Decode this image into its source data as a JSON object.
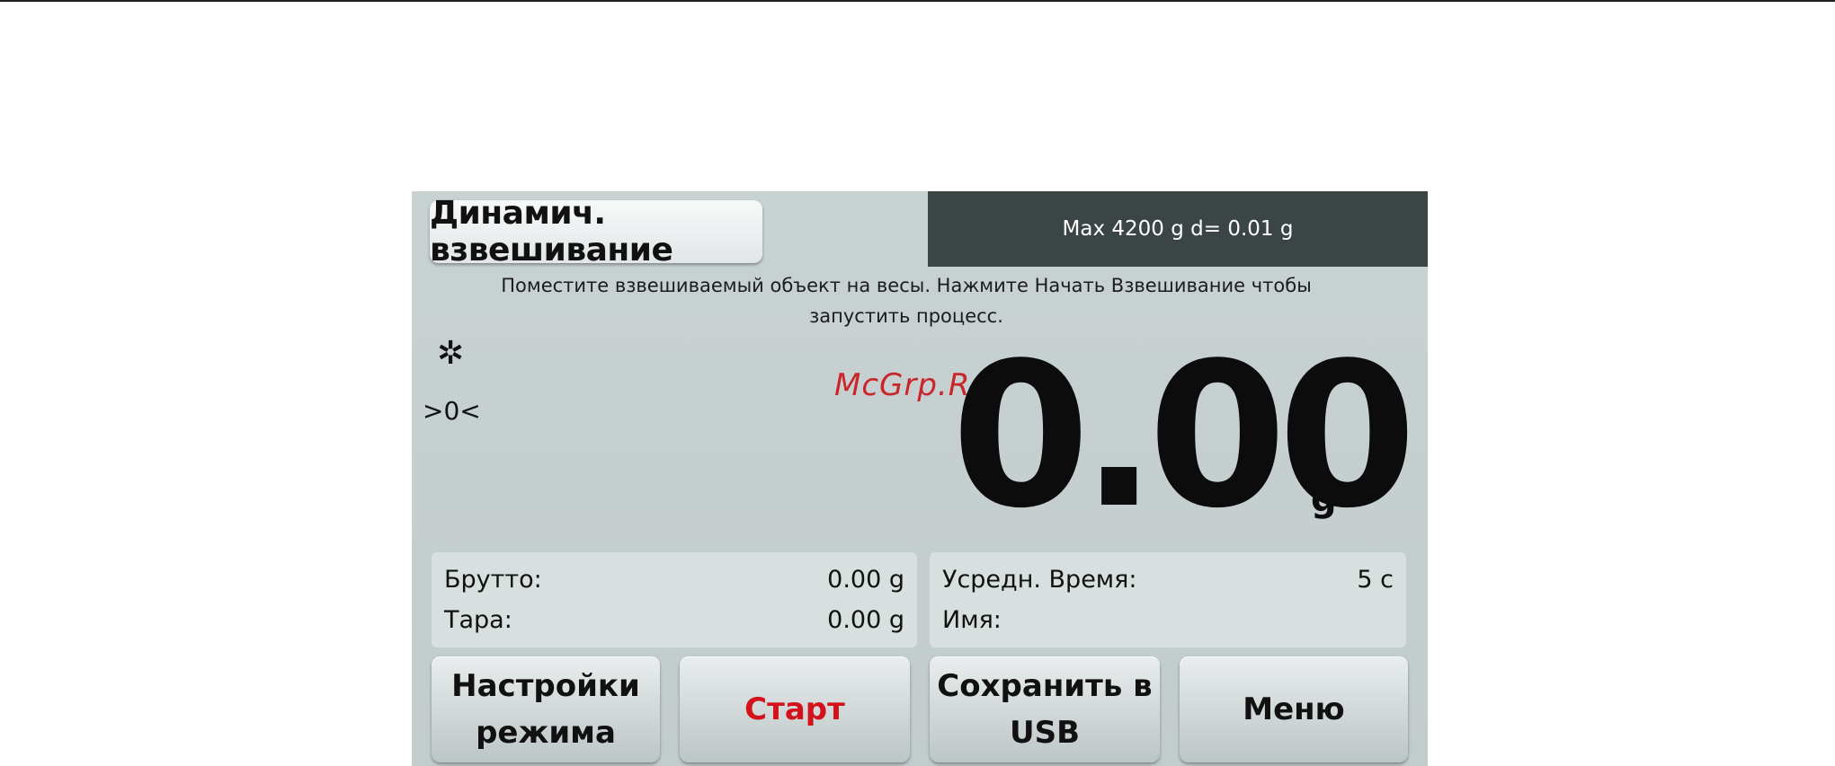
{
  "header": {
    "mode_title": "Динамич. взвешивание",
    "capacity": "Max 4200 g   d= 0.01 g"
  },
  "instruction": {
    "line1": "Поместите взвешиваемый объект на весы.  Нажмите Начать Взвешивание чтобы",
    "line2": "запустить процесс."
  },
  "indicators": {
    "stable_icon": "✲",
    "center_of_zero": ">0<"
  },
  "watermark": "McGrp.Ru",
  "display": {
    "weight": "0.00",
    "unit": "g"
  },
  "info_left": {
    "gross_label": "Брутто:",
    "gross_value": "0.00 g",
    "tare_label": "Тара:",
    "tare_value": "0.00 g"
  },
  "info_right": {
    "avg_time_label": "Усредн. Время:",
    "avg_time_value": "5 с",
    "name_label": "Имя:",
    "name_value": ""
  },
  "buttons": {
    "mode_settings": "Настройки\nрежима",
    "start": "Старт",
    "save_usb": "Сохранить в\nUSB",
    "menu": "Меню"
  },
  "colors": {
    "start_label": "#d4121b",
    "capacity_bar": "#3b4545",
    "screen_bg": "#c6cfd0"
  }
}
